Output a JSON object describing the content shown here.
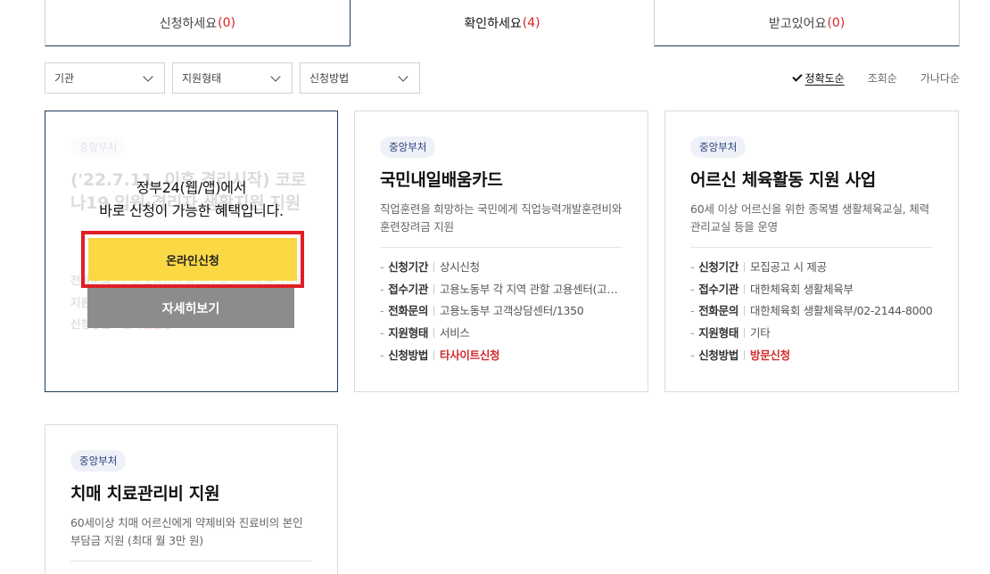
{
  "tabs": [
    {
      "label": "신청하세요",
      "count": "(0)"
    },
    {
      "label": "확인하세요",
      "count": "(4)"
    },
    {
      "label": "받고있어요",
      "count": "(0)"
    }
  ],
  "filters": [
    "기관",
    "지원형태",
    "신청방법"
  ],
  "sort": [
    "정확도순",
    "조회순",
    "가나다순"
  ],
  "labels": {
    "period": "신청기간",
    "agency": "접수기관",
    "phone": "전화문의",
    "type": "지원형태",
    "method": "신청방법"
  },
  "overlay": {
    "line1": "정부24(웹/앱)에서",
    "line2": "바로 신청이 가능한 혜택입니다.",
    "online_button": "온라인신청",
    "detail_button": "자세히보기"
  },
  "cards": [
    {
      "badge": "중앙부처",
      "title": "('22.7.11. 이후 격리시작) 코로나19 입원·격리자 생활지원 지원",
      "desc": "",
      "period": "",
      "agency": "",
      "phone": "건강보험공단 콜센터 등 지자체 주민센터",
      "type": "현금",
      "method": "온라인신청"
    },
    {
      "badge": "중앙부처",
      "title": "국민내일배움카드",
      "desc": "직업훈련을 희망하는 국민에게 직업능력개발훈련비와 훈련장려금 지원",
      "period": "상시신청",
      "agency": "고용노동부 각 지역 관할 고용센터(고용복지플러스센터)",
      "phone": "고용노동부 고객상담센터/1350",
      "type": "서비스",
      "method": "타사이트신청"
    },
    {
      "badge": "중앙부처",
      "title": "어르신 체육활동 지원 사업",
      "desc": "60세 이상 어르신을 위한 종목별 생활체육교실, 체력관리교실 등을 운영",
      "period": "모집공고 시 제공",
      "agency": "대한체육회 생활체육부",
      "phone": "대한체육회 생활체육부/02-2144-8000",
      "type": "기타",
      "method": "방문신청"
    },
    {
      "badge": "중앙부처",
      "title": "치매 치료관리비 지원",
      "desc": "60세이상 치매 어르신에게 약제비와 진료비의 본인부담금 지원 (최대 월 3만 원)"
    }
  ]
}
